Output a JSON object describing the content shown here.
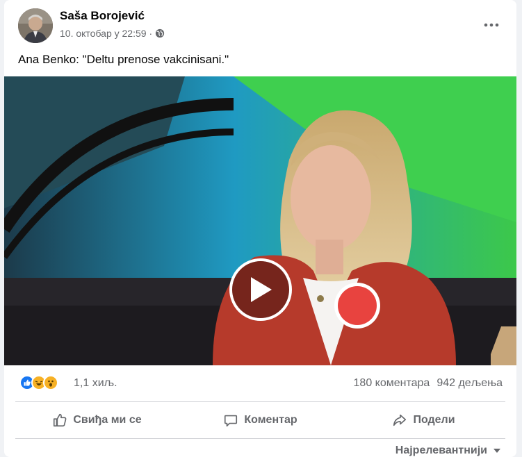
{
  "post": {
    "author": "Saša Borojević",
    "date": "10. октобар у 22:59",
    "separator": "·",
    "text": "Ana Benko: \"Deltu prenose vakcinisani.\""
  },
  "video": {
    "play_label": "play-icon"
  },
  "stats": {
    "reactions_count": "1,1 хиљ.",
    "comments": "180 коментара",
    "shares": "942 дељења"
  },
  "actions": {
    "like": "Свиђа ми се",
    "comment": "Коментар",
    "share": "Подели"
  },
  "sort": {
    "label": "Најрелевантнији"
  },
  "colors": {
    "text_secondary": "#65676b",
    "like_blue": "#1877f2",
    "haha_yellow": "#f7b125"
  }
}
